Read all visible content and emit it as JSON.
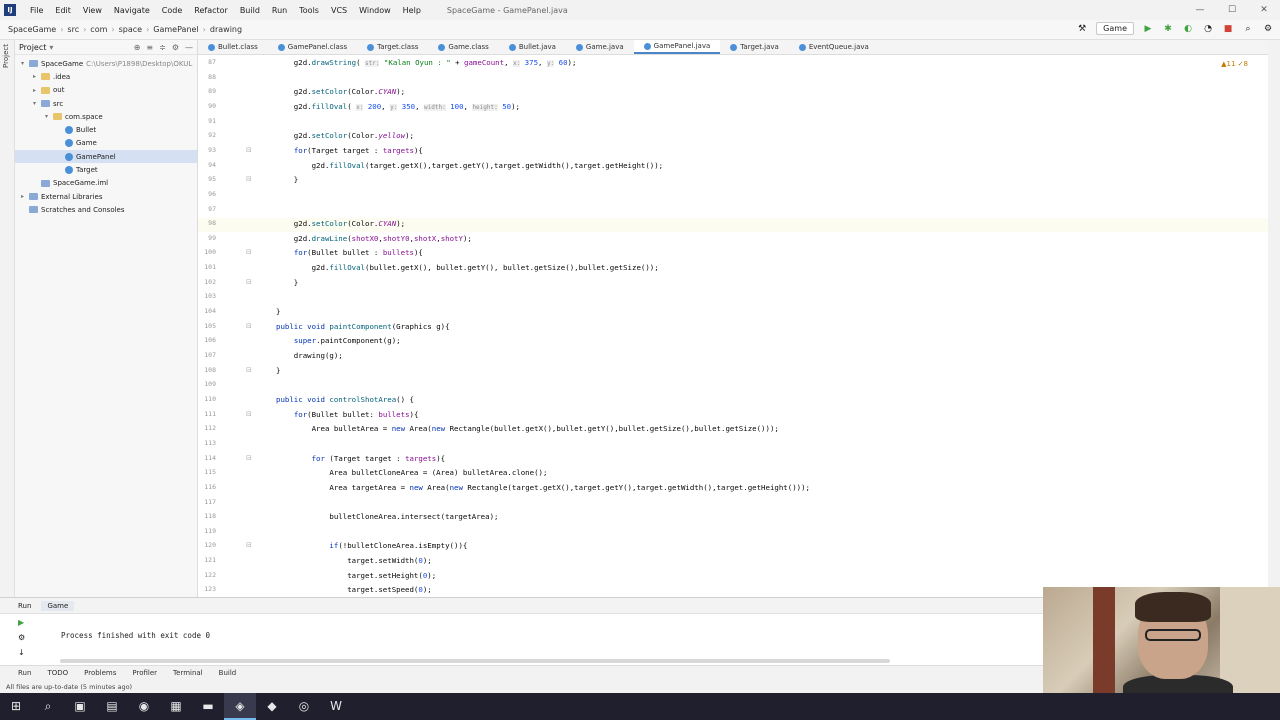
{
  "menubar": {
    "items": [
      "File",
      "Edit",
      "View",
      "Navigate",
      "Code",
      "Refactor",
      "Build",
      "Run",
      "Tools",
      "VCS",
      "Window",
      "Help"
    ],
    "window_title": "SpaceGame - GamePanel.java"
  },
  "navbar": {
    "crumbs": [
      "SpaceGame",
      "src",
      "com",
      "space",
      "GamePanel",
      "drawing"
    ],
    "run_config": "Game"
  },
  "project": {
    "title": "Project",
    "tree": [
      {
        "label": "SpaceGame",
        "path": "C:\\Users\\P1898\\Desktop\\OKUL",
        "depth": 0,
        "kind": "folder-blue",
        "arrow": "▾"
      },
      {
        "label": ".idea",
        "depth": 1,
        "kind": "folder",
        "arrow": "▸"
      },
      {
        "label": "out",
        "depth": 1,
        "kind": "folder",
        "arrow": "▸"
      },
      {
        "label": "src",
        "depth": 1,
        "kind": "folder-blue",
        "arrow": "▾"
      },
      {
        "label": "com.space",
        "depth": 2,
        "kind": "folder",
        "arrow": "▾"
      },
      {
        "label": "Bullet",
        "depth": 3,
        "kind": "class",
        "arrow": ""
      },
      {
        "label": "Game",
        "depth": 3,
        "kind": "class",
        "arrow": ""
      },
      {
        "label": "GamePanel",
        "depth": 3,
        "kind": "class",
        "arrow": "",
        "selected": true
      },
      {
        "label": "Target",
        "depth": 3,
        "kind": "class",
        "arrow": ""
      },
      {
        "label": "SpaceGame.iml",
        "depth": 1,
        "kind": "file",
        "arrow": ""
      },
      {
        "label": "External Libraries",
        "depth": 0,
        "kind": "folder-blue",
        "arrow": "▸"
      },
      {
        "label": "Scratches and Consoles",
        "depth": 0,
        "kind": "folder-blue",
        "arrow": ""
      }
    ]
  },
  "tabs": [
    {
      "label": "Bullet.class",
      "active": false
    },
    {
      "label": "GamePanel.class",
      "active": false
    },
    {
      "label": "Target.class",
      "active": false
    },
    {
      "label": "Game.class",
      "active": false
    },
    {
      "label": "Bullet.java",
      "active": false
    },
    {
      "label": "Game.java",
      "active": false
    },
    {
      "label": "GamePanel.java",
      "active": true
    },
    {
      "label": "Target.java",
      "active": false
    },
    {
      "label": "EventQueue.java",
      "active": false
    }
  ],
  "editor": {
    "inspection": "▲11 ✓8",
    "lines": [
      {
        "n": "87",
        "html": "    g2d.<span class='mth'>drawString</span>( <span class='hint'>str:</span> <span class='str'>\"Kalan Oyun : \"</span> + <span class='fld'>gameCount</span>, <span class='hint'>x:</span> <span class='num'>375</span>, <span class='hint'>y:</span> <span class='num'>60</span>);"
      },
      {
        "n": "88",
        "html": ""
      },
      {
        "n": "89",
        "html": "    g2d.<span class='mth'>setColor</span>(Color.<span class='cst'>CYAN</span>);"
      },
      {
        "n": "90",
        "html": "    g2d.<span class='mth'>fillOval</span>( <span class='hint'>x:</span> <span class='num'>200</span>, <span class='hint'>y:</span> <span class='num'>350</span>, <span class='hint'>width:</span> <span class='num'>100</span>, <span class='hint'>height:</span> <span class='num'>50</span>);"
      },
      {
        "n": "91",
        "html": ""
      },
      {
        "n": "92",
        "html": "    g2d.<span class='mth'>setColor</span>(Color.<span class='cst'>yellow</span>);"
      },
      {
        "n": "93",
        "html": "    <span class='kw'>for</span>(Target target : <span class='fld'>targets</span>){"
      },
      {
        "n": "94",
        "html": "        g2d.<span class='mth'>fillOval</span>(target.getX(),target.getY(),target.getWidth(),target.getHeight());"
      },
      {
        "n": "95",
        "html": "    }"
      },
      {
        "n": "96",
        "html": ""
      },
      {
        "n": "97",
        "html": ""
      },
      {
        "n": "98",
        "html": "    g2d.<span class='mth'>setColor</span>(Color.<span class='cst'>CYAN</span>);"
      },
      {
        "n": "99",
        "html": "    g2d.<span class='mth'>drawLine</span>(<span class='fld'>shotX0</span>,<span class='fld'>shotY0</span>,<span class='fld'>shotX</span>,<span class='fld'>shotY</span>);"
      },
      {
        "n": "100",
        "html": "    <span class='kw'>for</span>(Bullet bullet : <span class='fld'>bullets</span>){"
      },
      {
        "n": "101",
        "html": "        g2d.<span class='mth'>fillOval</span>(bullet.getX(), bullet.getY(), bullet.getSize(),bullet.getSize());"
      },
      {
        "n": "102",
        "html": "    }"
      },
      {
        "n": "103",
        "html": ""
      },
      {
        "n": "104",
        "html": "}"
      },
      {
        "n": "105",
        "html": "<span class='kw'>public void</span> <span class='mth'>paintComponent</span>(Graphics g){"
      },
      {
        "n": "106",
        "html": "    <span class='kw'>super</span>.paintComponent(g);"
      },
      {
        "n": "107",
        "html": "    drawing(g);"
      },
      {
        "n": "108",
        "html": "}"
      },
      {
        "n": "109",
        "html": ""
      },
      {
        "n": "110",
        "html": "<span class='kw'>public void</span> <span class='mth'>controlShotArea</span>() {"
      },
      {
        "n": "111",
        "html": "    <span class='kw'>for</span>(Bullet bullet: <span class='fld'>bullets</span>){"
      },
      {
        "n": "112",
        "html": "        Area bulletArea = <span class='kw'>new</span> Area(<span class='kw'>new</span> Rectangle(bullet.getX(),bullet.getY(),bullet.getSize(),bullet.getSize()));"
      },
      {
        "n": "113",
        "html": ""
      },
      {
        "n": "114",
        "html": "        <span class='kw'>for</span> (Target target : <span class='fld'>targets</span>){"
      },
      {
        "n": "115",
        "html": "            Area bulletCloneArea = (Area) bulletArea.clone();"
      },
      {
        "n": "116",
        "html": "            Area targetArea = <span class='kw'>new</span> Area(<span class='kw'>new</span> Rectangle(target.getX(),target.getY(),target.getWidth(),target.getHeight()));"
      },
      {
        "n": "117",
        "html": ""
      },
      {
        "n": "118",
        "html": "            bulletCloneArea.intersect(targetArea);"
      },
      {
        "n": "119",
        "html": ""
      },
      {
        "n": "120",
        "html": "            <span class='kw'>if</span>(!bulletCloneArea.isEmpty()){"
      },
      {
        "n": "121",
        "html": "                target.setWidth(<span class='num'>0</span>);"
      },
      {
        "n": "122",
        "html": "                target.setHeight(<span class='num'>0</span>);"
      },
      {
        "n": "123",
        "html": "                target.setSpeed(<span class='num'>0</span>);"
      }
    ]
  },
  "run": {
    "label": "Run",
    "tab": "Game",
    "output": "Process finished with exit code 0"
  },
  "toolstrip": [
    "Run",
    "TODO",
    "Problems",
    "Profiler",
    "Terminal",
    "Build"
  ],
  "status": "All files are up-to-date (5 minutes ago)",
  "taskbar": [
    "⊞",
    "⌕",
    "▣",
    "▤",
    "◉",
    "▦",
    "▬",
    "◈",
    "◆",
    "◎",
    "W"
  ]
}
